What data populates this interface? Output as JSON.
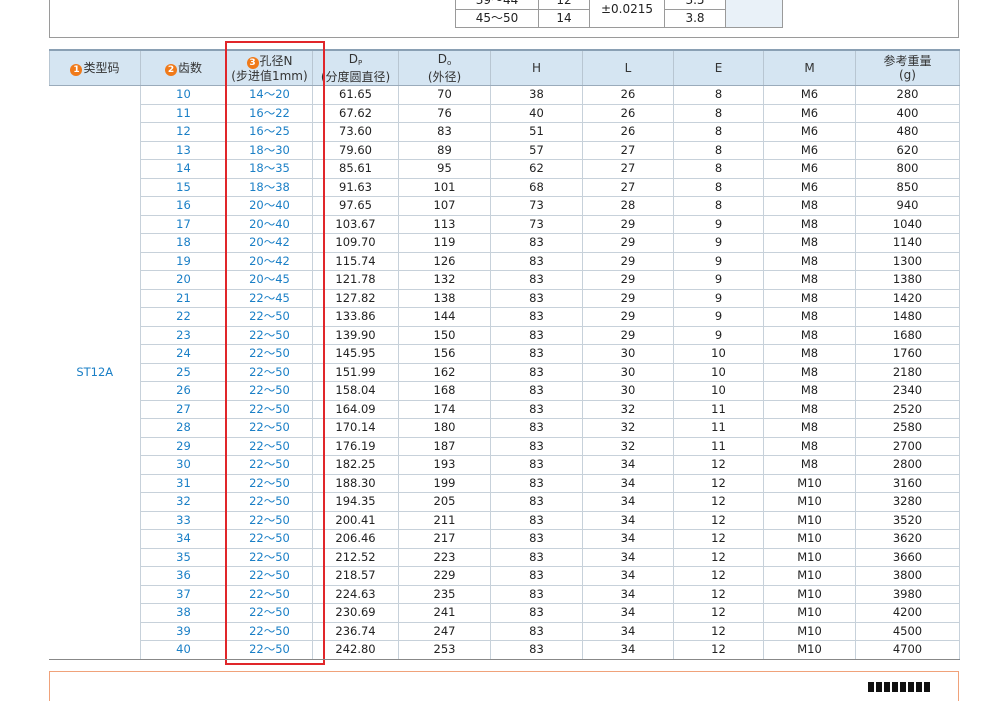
{
  "top_table": {
    "rows": [
      {
        "col1": "39～44",
        "col2": "12",
        "col3": "",
        "col4": "3.5"
      },
      {
        "col1": "45～50",
        "col2": "14",
        "col3": "",
        "col4": "3.8"
      }
    ],
    "tolerance": "±0.0215"
  },
  "headers": {
    "type_code": "类型码",
    "type_code_num": "1",
    "teeth": "齿数",
    "teeth_num": "2",
    "bore_num": "3",
    "bore_l1": "孔径N",
    "bore_l2": "(步进值1mm)",
    "dp_main": "D",
    "dp_sub": "P",
    "dp_l2": "(分度圆直径)",
    "do_main": "D",
    "do_sub": "o",
    "do_l2": "(外径)",
    "h": "H",
    "l": "L",
    "e": "E",
    "m": "M",
    "weight_l1": "参考重量",
    "weight_l2": "(g)"
  },
  "type_code_value": "ST12A",
  "rows": [
    {
      "z": "10",
      "n": "14～20",
      "dp": "61.65",
      "do": "70",
      "h": "38",
      "l": "26",
      "e": "8",
      "m": "M6",
      "w": "280"
    },
    {
      "z": "11",
      "n": "16～22",
      "dp": "67.62",
      "do": "76",
      "h": "40",
      "l": "26",
      "e": "8",
      "m": "M6",
      "w": "400"
    },
    {
      "z": "12",
      "n": "16～25",
      "dp": "73.60",
      "do": "83",
      "h": "51",
      "l": "26",
      "e": "8",
      "m": "M6",
      "w": "480"
    },
    {
      "z": "13",
      "n": "18～30",
      "dp": "79.60",
      "do": "89",
      "h": "57",
      "l": "27",
      "e": "8",
      "m": "M6",
      "w": "620"
    },
    {
      "z": "14",
      "n": "18～35",
      "dp": "85.61",
      "do": "95",
      "h": "62",
      "l": "27",
      "e": "8",
      "m": "M6",
      "w": "800"
    },
    {
      "z": "15",
      "n": "18～38",
      "dp": "91.63",
      "do": "101",
      "h": "68",
      "l": "27",
      "e": "8",
      "m": "M6",
      "w": "850"
    },
    {
      "z": "16",
      "n": "20～40",
      "dp": "97.65",
      "do": "107",
      "h": "73",
      "l": "28",
      "e": "8",
      "m": "M8",
      "w": "940"
    },
    {
      "z": "17",
      "n": "20～40",
      "dp": "103.67",
      "do": "113",
      "h": "73",
      "l": "29",
      "e": "9",
      "m": "M8",
      "w": "1040"
    },
    {
      "z": "18",
      "n": "20～42",
      "dp": "109.70",
      "do": "119",
      "h": "83",
      "l": "29",
      "e": "9",
      "m": "M8",
      "w": "1140"
    },
    {
      "z": "19",
      "n": "20～42",
      "dp": "115.74",
      "do": "126",
      "h": "83",
      "l": "29",
      "e": "9",
      "m": "M8",
      "w": "1300"
    },
    {
      "z": "20",
      "n": "20～45",
      "dp": "121.78",
      "do": "132",
      "h": "83",
      "l": "29",
      "e": "9",
      "m": "M8",
      "w": "1380"
    },
    {
      "z": "21",
      "n": "22～45",
      "dp": "127.82",
      "do": "138",
      "h": "83",
      "l": "29",
      "e": "9",
      "m": "M8",
      "w": "1420"
    },
    {
      "z": "22",
      "n": "22～50",
      "dp": "133.86",
      "do": "144",
      "h": "83",
      "l": "29",
      "e": "9",
      "m": "M8",
      "w": "1480"
    },
    {
      "z": "23",
      "n": "22～50",
      "dp": "139.90",
      "do": "150",
      "h": "83",
      "l": "29",
      "e": "9",
      "m": "M8",
      "w": "1680"
    },
    {
      "z": "24",
      "n": "22～50",
      "dp": "145.95",
      "do": "156",
      "h": "83",
      "l": "30",
      "e": "10",
      "m": "M8",
      "w": "1760"
    },
    {
      "z": "25",
      "n": "22～50",
      "dp": "151.99",
      "do": "162",
      "h": "83",
      "l": "30",
      "e": "10",
      "m": "M8",
      "w": "2180"
    },
    {
      "z": "26",
      "n": "22～50",
      "dp": "158.04",
      "do": "168",
      "h": "83",
      "l": "30",
      "e": "10",
      "m": "M8",
      "w": "2340"
    },
    {
      "z": "27",
      "n": "22～50",
      "dp": "164.09",
      "do": "174",
      "h": "83",
      "l": "32",
      "e": "11",
      "m": "M8",
      "w": "2520"
    },
    {
      "z": "28",
      "n": "22～50",
      "dp": "170.14",
      "do": "180",
      "h": "83",
      "l": "32",
      "e": "11",
      "m": "M8",
      "w": "2580"
    },
    {
      "z": "29",
      "n": "22～50",
      "dp": "176.19",
      "do": "187",
      "h": "83",
      "l": "32",
      "e": "11",
      "m": "M8",
      "w": "2700"
    },
    {
      "z": "30",
      "n": "22～50",
      "dp": "182.25",
      "do": "193",
      "h": "83",
      "l": "34",
      "e": "12",
      "m": "M8",
      "w": "2800"
    },
    {
      "z": "31",
      "n": "22～50",
      "dp": "188.30",
      "do": "199",
      "h": "83",
      "l": "34",
      "e": "12",
      "m": "M10",
      "w": "3160"
    },
    {
      "z": "32",
      "n": "22～50",
      "dp": "194.35",
      "do": "205",
      "h": "83",
      "l": "34",
      "e": "12",
      "m": "M10",
      "w": "3280"
    },
    {
      "z": "33",
      "n": "22～50",
      "dp": "200.41",
      "do": "211",
      "h": "83",
      "l": "34",
      "e": "12",
      "m": "M10",
      "w": "3520"
    },
    {
      "z": "34",
      "n": "22～50",
      "dp": "206.46",
      "do": "217",
      "h": "83",
      "l": "34",
      "e": "12",
      "m": "M10",
      "w": "3620"
    },
    {
      "z": "35",
      "n": "22～50",
      "dp": "212.52",
      "do": "223",
      "h": "83",
      "l": "34",
      "e": "12",
      "m": "M10",
      "w": "3660"
    },
    {
      "z": "36",
      "n": "22～50",
      "dp": "218.57",
      "do": "229",
      "h": "83",
      "l": "34",
      "e": "12",
      "m": "M10",
      "w": "3800"
    },
    {
      "z": "37",
      "n": "22～50",
      "dp": "224.63",
      "do": "235",
      "h": "83",
      "l": "34",
      "e": "12",
      "m": "M10",
      "w": "3980"
    },
    {
      "z": "38",
      "n": "22～50",
      "dp": "230.69",
      "do": "241",
      "h": "83",
      "l": "34",
      "e": "12",
      "m": "M10",
      "w": "4200"
    },
    {
      "z": "39",
      "n": "22～50",
      "dp": "236.74",
      "do": "247",
      "h": "83",
      "l": "34",
      "e": "12",
      "m": "M10",
      "w": "4500"
    },
    {
      "z": "40",
      "n": "22～50",
      "dp": "242.80",
      "do": "253",
      "h": "83",
      "l": "34",
      "e": "12",
      "m": "M10",
      "w": "4700"
    }
  ],
  "colors": {
    "header_bg": "#d5e5f2",
    "link_blue": "#1a7fc6",
    "highlight_red": "#e0262a",
    "badge_orange": "#f07a1a"
  }
}
